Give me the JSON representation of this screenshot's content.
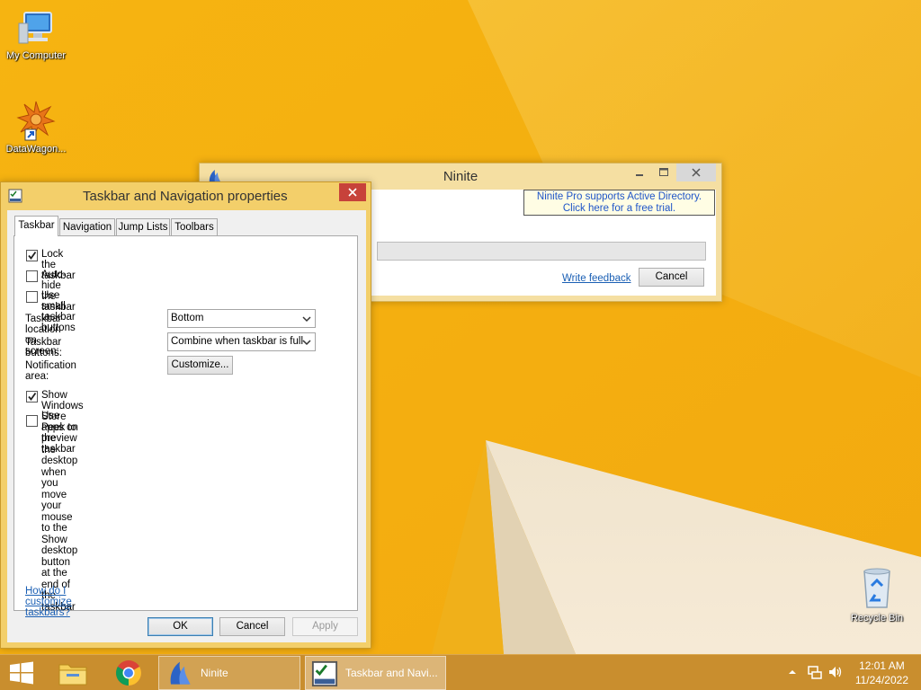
{
  "desktop": {
    "icons": [
      {
        "label": "My Computer",
        "icon": "computer-icon"
      },
      {
        "label": "DataWagon...",
        "icon": "datawagon-icon"
      },
      {
        "label": "Recycle Bin",
        "icon": "recycle-bin-icon"
      }
    ]
  },
  "ninite": {
    "title": "Ninite",
    "promo_line1": "Ninite Pro supports Active Directory.",
    "promo_line2": "Click here for a free trial.",
    "feedback_link": "Write feedback",
    "cancel_label": "Cancel"
  },
  "taskbar_props": {
    "title": "Taskbar and Navigation properties",
    "tabs": [
      {
        "label": "Taskbar",
        "active": true
      },
      {
        "label": "Navigation",
        "active": false
      },
      {
        "label": "Jump Lists",
        "active": false
      },
      {
        "label": "Toolbars",
        "active": false
      }
    ],
    "checkboxes": [
      {
        "label": "Lock the taskbar",
        "checked": true
      },
      {
        "label": "Auto-hide the taskbar",
        "checked": false
      },
      {
        "label": "Use small taskbar buttons",
        "checked": false
      }
    ],
    "location_label": "Taskbar location on screen:",
    "location_value": "Bottom",
    "buttons_label": "Taskbar buttons:",
    "buttons_value": "Combine when taskbar is full",
    "notification_label": "Notification area:",
    "customize_label": "Customize...",
    "store_apps": {
      "label": "Show Windows Store apps on the taskbar",
      "checked": true
    },
    "peek": {
      "line1": "Use Peek to preview the desktop when you move your mouse to the",
      "line2": "Show desktop button at the end of the taskbar",
      "checked": false
    },
    "help_link": "How do I customize taskbars?",
    "ok_label": "OK",
    "cancel_label": "Cancel",
    "apply_label": "Apply"
  },
  "taskbar": {
    "tasks": [
      {
        "label": "Ninite",
        "icon": "ninite-icon"
      },
      {
        "label": "Taskbar and Navi...",
        "icon": "taskbar-properties-icon"
      }
    ],
    "pinned": [
      "start-icon",
      "file-explorer-icon",
      "chrome-icon"
    ],
    "tray_icons": [
      "show-hidden-icons-icon",
      "network-icon",
      "volume-icon"
    ],
    "time": "12:01 AM",
    "date": "11/24/2022"
  }
}
